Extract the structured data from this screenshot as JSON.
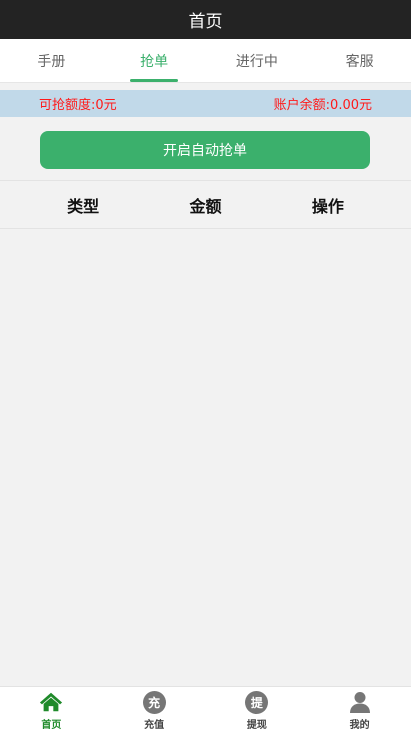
{
  "header": {
    "title": "首页"
  },
  "tabs": [
    {
      "label": "手册",
      "active": false
    },
    {
      "label": "抢单",
      "active": true
    },
    {
      "label": "进行中",
      "active": false
    },
    {
      "label": "客服",
      "active": false
    }
  ],
  "balance": {
    "quota": "可抢额度:0元",
    "account": "账户余额:0.00元"
  },
  "auto_button": {
    "label": "开启自动抢单"
  },
  "table": {
    "columns": [
      "类型",
      "金额",
      "操作"
    ]
  },
  "bottom_nav": [
    {
      "label": "首页",
      "icon": "home-icon",
      "active": true
    },
    {
      "label": "充值",
      "icon": "recharge-icon",
      "glyph": "充",
      "active": false
    },
    {
      "label": "提现",
      "icon": "withdraw-icon",
      "glyph": "提",
      "active": false
    },
    {
      "label": "我的",
      "icon": "user-icon",
      "active": false
    }
  ],
  "colors": {
    "accent": "#3bb06c",
    "header_bg": "#232323",
    "balance_bg": "#c1d9e9",
    "balance_text": "#ff1a1a",
    "home_active": "#1f8a2a"
  }
}
